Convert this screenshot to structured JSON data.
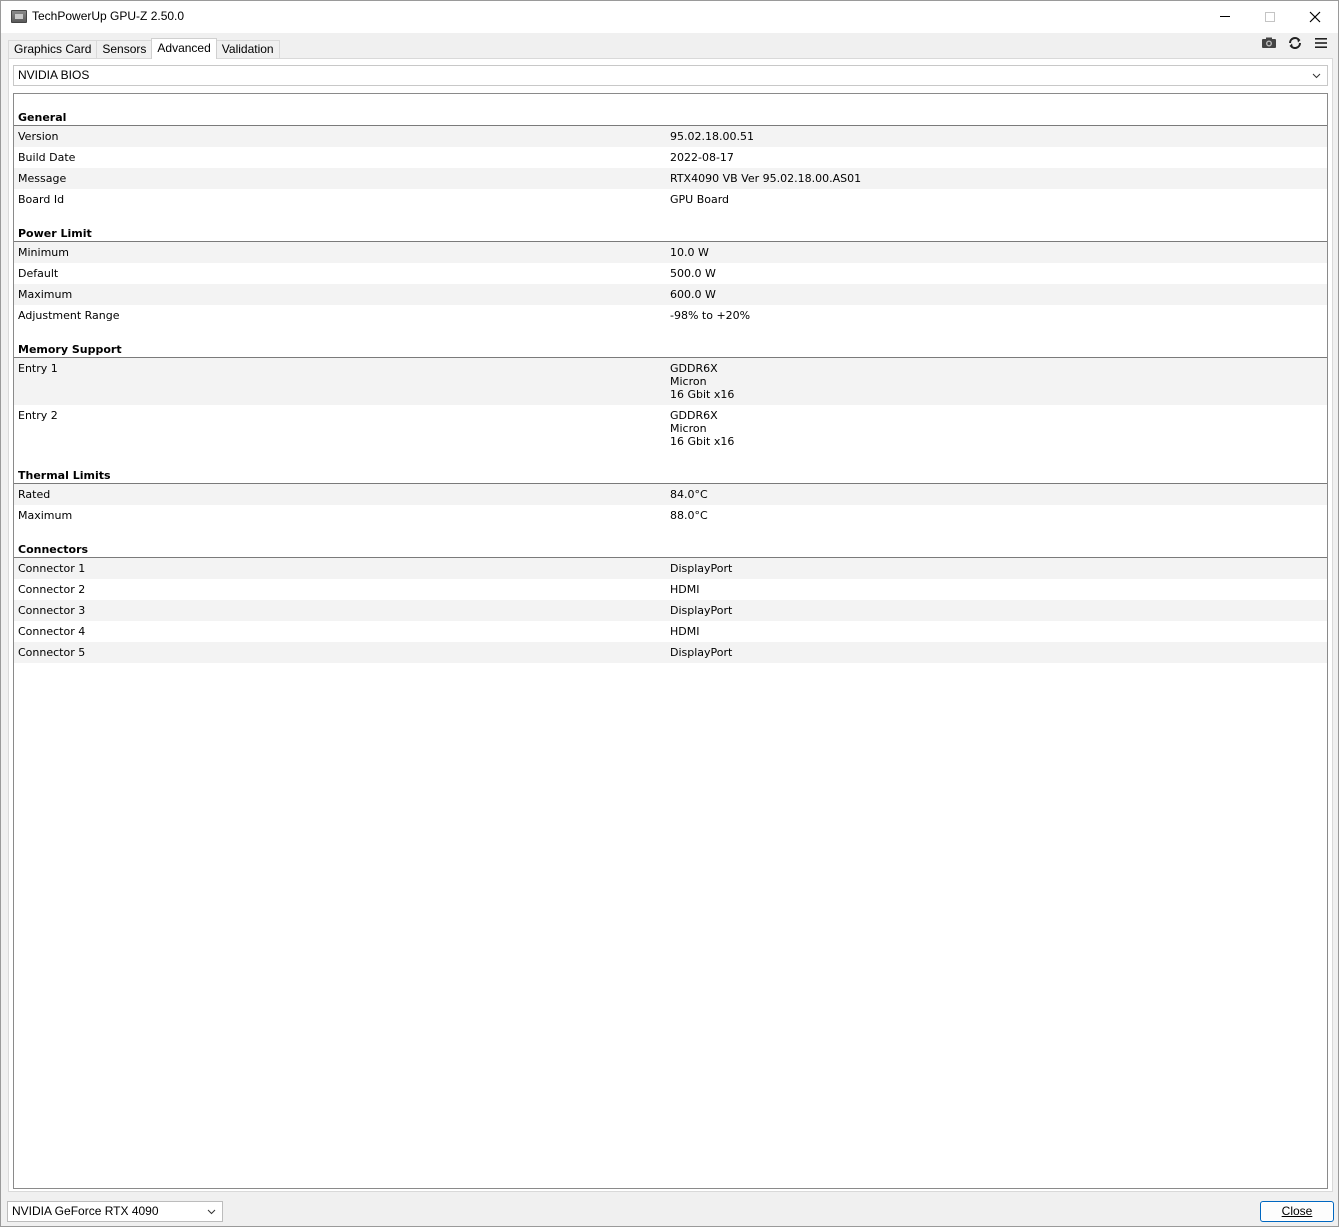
{
  "window": {
    "title": "TechPowerUp GPU-Z 2.50.0"
  },
  "icons": {
    "app": "gpu-z-app-icon",
    "minimize": "minimize-icon",
    "maximize": "maximize-icon",
    "close": "close-icon",
    "screenshot": "camera-icon",
    "refresh": "refresh-icon",
    "menu": "hamburger-menu-icon",
    "dropdown": "chevron-down-icon"
  },
  "tabs": [
    {
      "label": "Graphics Card",
      "active": false
    },
    {
      "label": "Sensors",
      "active": false
    },
    {
      "label": "Advanced",
      "active": true
    },
    {
      "label": "Validation",
      "active": false
    }
  ],
  "category_select": {
    "value": "NVIDIA BIOS"
  },
  "sections": [
    {
      "title": "General",
      "rows": [
        {
          "label": "Version",
          "value": "95.02.18.00.51"
        },
        {
          "label": "Build Date",
          "value": "2022-08-17"
        },
        {
          "label": "Message",
          "value": "RTX4090 VB Ver 95.02.18.00.AS01"
        },
        {
          "label": "Board Id",
          "value": "GPU Board"
        }
      ]
    },
    {
      "title": "Power Limit",
      "rows": [
        {
          "label": "Minimum",
          "value": "10.0 W"
        },
        {
          "label": "Default",
          "value": "500.0 W"
        },
        {
          "label": "Maximum",
          "value": "600.0 W"
        },
        {
          "label": "Adjustment Range",
          "value": "-98% to +20%"
        }
      ]
    },
    {
      "title": "Memory Support",
      "rows": [
        {
          "label": "Entry 1",
          "value": "GDDR6X\nMicron\n16 Gbit x16"
        },
        {
          "label": "Entry 2",
          "value": "GDDR6X\nMicron\n16 Gbit x16"
        }
      ]
    },
    {
      "title": "Thermal Limits",
      "rows": [
        {
          "label": "Rated",
          "value": "84.0°C"
        },
        {
          "label": "Maximum",
          "value": "88.0°C"
        }
      ]
    },
    {
      "title": "Connectors",
      "rows": [
        {
          "label": "Connector 1",
          "value": "DisplayPort"
        },
        {
          "label": "Connector 2",
          "value": "HDMI"
        },
        {
          "label": "Connector 3",
          "value": "DisplayPort"
        },
        {
          "label": "Connector 4",
          "value": "HDMI"
        },
        {
          "label": "Connector 5",
          "value": "DisplayPort"
        }
      ]
    }
  ],
  "gpu_select": {
    "value": "NVIDIA GeForce RTX 4090"
  },
  "close_button": {
    "label": "Close"
  },
  "colors": {
    "accent_border": "#0067c0",
    "row_alt": "#f3f3f3"
  }
}
